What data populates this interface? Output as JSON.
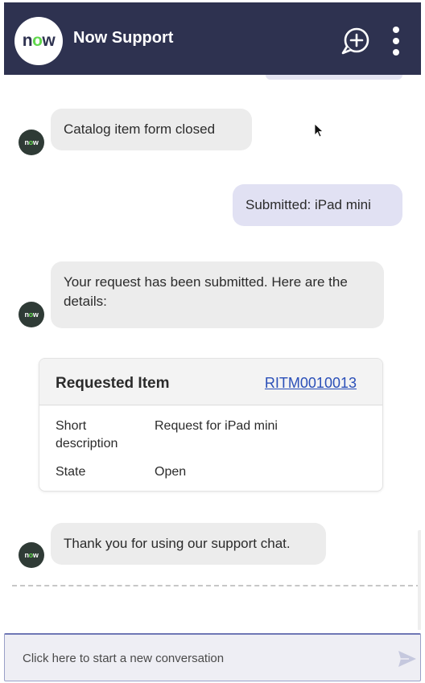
{
  "header": {
    "logo_text_n": "n",
    "logo_text_o": "o",
    "logo_text_w": "w",
    "title": "Now Support",
    "new_chat_icon": "chat-plus-icon",
    "menu_icon": "vertical-dots-icon"
  },
  "messages": [
    {
      "from": "bot",
      "text": "Catalog item form closed"
    },
    {
      "from": "user",
      "text": "Submitted: iPad mini"
    },
    {
      "from": "bot",
      "text": "Your request has been submitted. Here are the details:"
    },
    {
      "from": "bot",
      "text": "Thank you for using our support chat."
    }
  ],
  "card": {
    "title": "Requested Item",
    "link": "RITM0010013",
    "rows": [
      {
        "label": "Short description",
        "value": "Request for iPad mini"
      },
      {
        "label": "State",
        "value": "Open"
      }
    ]
  },
  "input": {
    "placeholder": "Click here to start a new conversation",
    "value": ""
  },
  "colors": {
    "header_bg": "#2e3250",
    "bot_bubble": "#ececec",
    "user_bubble": "#e1e1f3",
    "link": "#2a4fb8",
    "brand_green": "#62d84e"
  }
}
